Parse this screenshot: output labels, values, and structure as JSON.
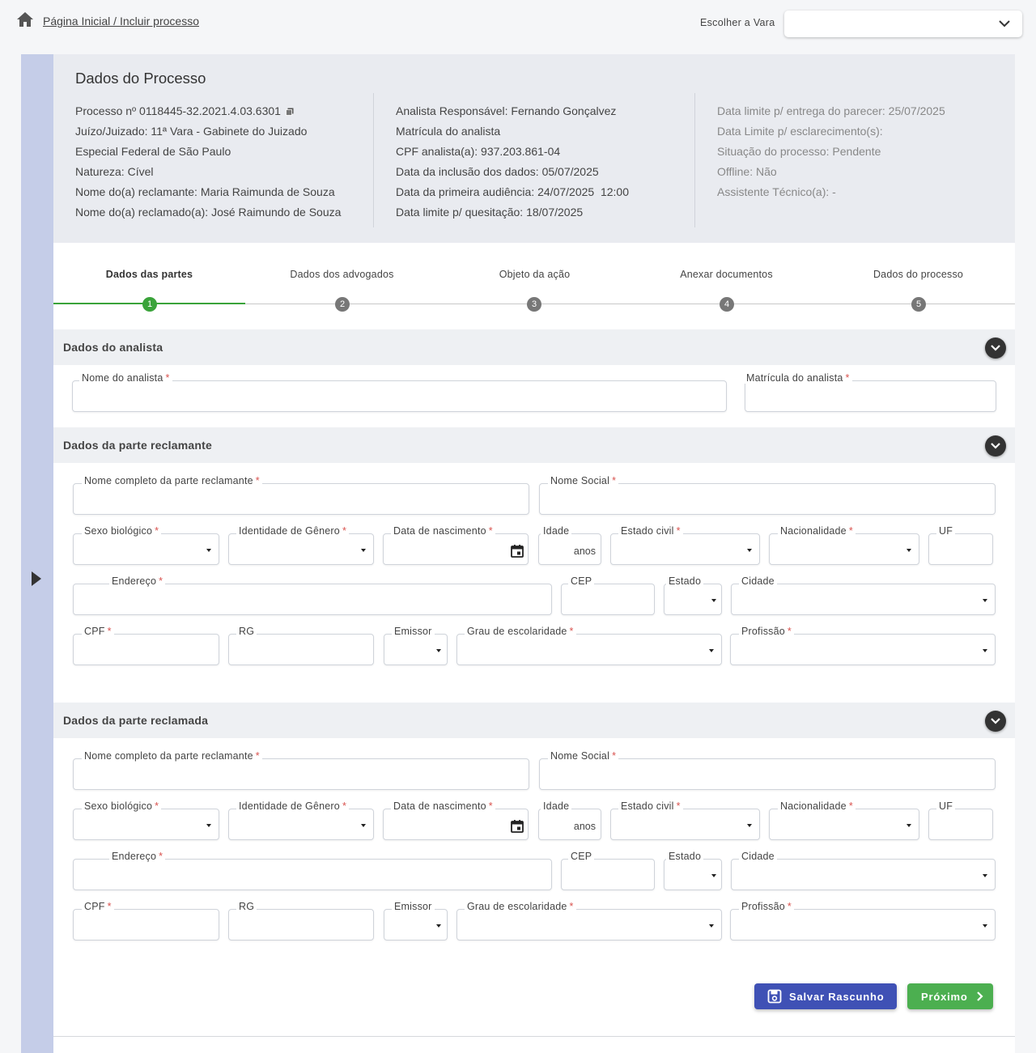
{
  "breadcrumb": "Página Inicial / Incluir processo",
  "vara": {
    "label": "Escolher a Vara",
    "value": ""
  },
  "processo": {
    "title": "Dados do Processo",
    "col1": [
      {
        "k": "Processo nº",
        "v": "0118445-32.2021.4.03.6301"
      },
      {
        "k": "Juízo/Juizado:",
        "v": "11ª Vara - Gabinete do Juizado"
      },
      {
        "k": "",
        "v": "Especial Federal de São Paulo"
      },
      {
        "k": "Natureza:",
        "v": "Cível"
      },
      {
        "k": "Nome do(a) reclamante:",
        "v": "Maria Raimunda de Souza"
      },
      {
        "k": "Nome do(a) reclamado(a):",
        "v": "José Raimundo de Souza"
      }
    ],
    "col2": [
      {
        "k": "Analista Responsável:",
        "v": "Fernando Gonçalvez"
      },
      {
        "k": "Matrícula do analista",
        "v": ""
      },
      {
        "k": "CPF analista(a):",
        "v": "937.203.861-04"
      },
      {
        "k": "Data da inclusão dos dados:",
        "v": "05/07/2025"
      },
      {
        "k": "Data da primeira audiência:",
        "v": "24/07/2025  12:00"
      },
      {
        "k": "Data limite p/ quesitação:",
        "v": "18/07/2025"
      }
    ],
    "col3": [
      {
        "k": "Data limite p/ entrega do parecer:",
        "v": "25/07/2025"
      },
      {
        "k": "Data Limite p/ esclarecimento(s):",
        "v": ""
      },
      {
        "k": "Situação do processo:",
        "v": "Pendente"
      },
      {
        "k": "Offline:",
        "v": "Não"
      },
      {
        "k": "Assistente Técnico(a):",
        "v": "-"
      }
    ]
  },
  "steps": [
    {
      "label": "Dados das partes",
      "num": "1"
    },
    {
      "label": "Dados dos advogados",
      "num": "2"
    },
    {
      "label": "Objeto da ação",
      "num": "3"
    },
    {
      "label": "Anexar documentos",
      "num": "4"
    },
    {
      "label": "Dados do processo",
      "num": "5"
    }
  ],
  "analista": {
    "title": "Dados do analista",
    "nome_label": "Nome do analista",
    "matricula_label": "Matrícula do analista"
  },
  "reclamante": {
    "title": "Dados da parte reclamante",
    "nome_completo": "Nome completo da parte reclamante",
    "nome_social": "Nome Social",
    "sexo": "Sexo biológico",
    "genero": "Identidade de Gênero",
    "nascimento": "Data de nascimento",
    "idade": "Idade",
    "idade_suffix": "anos",
    "estado_civil": "Estado civil",
    "nacionalidade": "Nacionalidade",
    "uf": "UF",
    "endereco": "Endereço",
    "cep": "CEP",
    "estado": "Estado",
    "cidade": "Cidade",
    "cpf": "CPF",
    "rg": "RG",
    "emissor": "Emissor",
    "escolaridade": "Grau de escolaridade",
    "profissao": "Profissão"
  },
  "reclamada": {
    "title": "Dados da parte reclamada",
    "nome_completo": "Nome completo da parte reclamante",
    "nome_social": "Nome Social",
    "sexo": "Sexo biológico",
    "genero": "Identidade de Gênero",
    "nascimento": "Data de nascimento",
    "idade": "Idade",
    "idade_suffix": "anos",
    "estado_civil": "Estado civil",
    "nacionalidade": "Nacionalidade",
    "uf": "UF",
    "endereco": "Endereço",
    "cep": "CEP",
    "estado": "Estado",
    "cidade": "Cidade",
    "cpf": "CPF",
    "rg": "RG",
    "emissor": "Emissor",
    "escolaridade": "Grau de escolaridade",
    "profissao": "Profissão"
  },
  "buttons": {
    "save": "Salvar Rascunho",
    "next": "Próximo"
  },
  "colors": {
    "primary": "#3f51b5",
    "success": "#4caf50",
    "step_active": "#3aa33a",
    "required": "#d9534f",
    "sidebar": "#c5cde8"
  }
}
